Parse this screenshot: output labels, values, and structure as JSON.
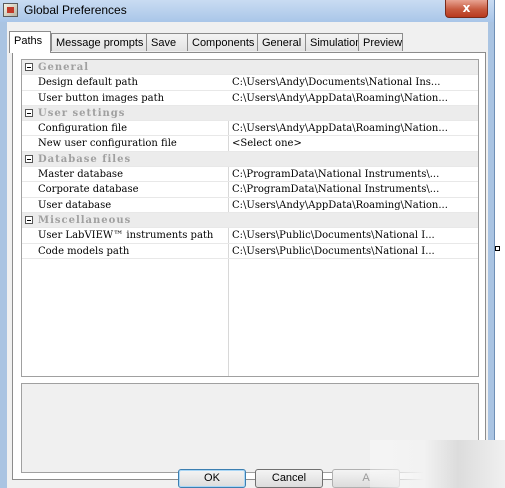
{
  "window": {
    "title": "Global Preferences",
    "close_label": "x"
  },
  "tabs": [
    {
      "label": "Paths",
      "active": true
    },
    {
      "label": "Message prompts",
      "active": false
    },
    {
      "label": "Save",
      "active": false
    },
    {
      "label": "Components",
      "active": false
    },
    {
      "label": "General",
      "active": false
    },
    {
      "label": "Simulation",
      "active": false
    },
    {
      "label": "Preview",
      "active": false
    }
  ],
  "categories": [
    {
      "label": "General",
      "rows": [
        {
          "name": "Design default path",
          "value": "C:\\Users\\Andy\\Documents\\National Ins..."
        },
        {
          "name": "User button images path",
          "value": "C:\\Users\\Andy\\AppData\\Roaming\\Nation..."
        }
      ]
    },
    {
      "label": "User settings",
      "rows": [
        {
          "name": "Configuration file",
          "value": "C:\\Users\\Andy\\AppData\\Roaming\\Nation..."
        },
        {
          "name": "New user configuration file",
          "value": "<Select one>"
        }
      ]
    },
    {
      "label": "Database files",
      "rows": [
        {
          "name": "Master database",
          "value": "C:\\ProgramData\\National Instruments\\..."
        },
        {
          "name": "Corporate database",
          "value": "C:\\ProgramData\\National Instruments\\..."
        },
        {
          "name": "User database",
          "value": "C:\\Users\\Andy\\AppData\\Roaming\\Nation..."
        }
      ]
    },
    {
      "label": "Miscellaneous",
      "rows": [
        {
          "name": "User LabVIEW™ instruments path",
          "value": "C:\\Users\\Public\\Documents\\National I..."
        },
        {
          "name": "Code models path",
          "value": "C:\\Users\\Public\\Documents\\National I..."
        }
      ]
    }
  ],
  "buttons": {
    "ok": "OK",
    "cancel": "Cancel",
    "apply": "A"
  }
}
